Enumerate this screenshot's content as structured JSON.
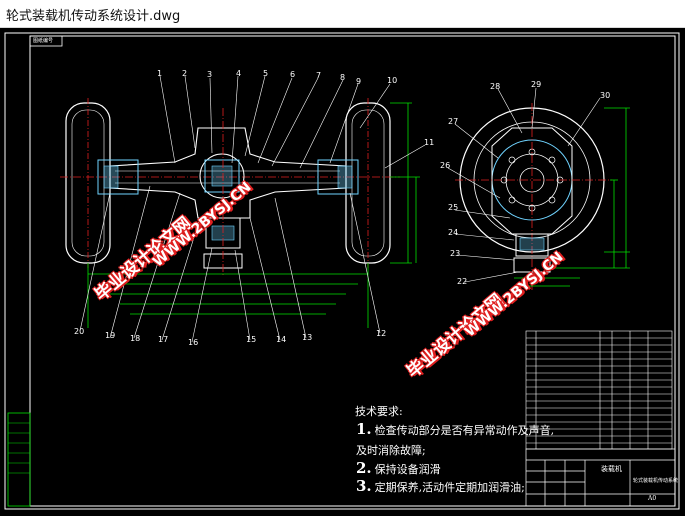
{
  "window": {
    "title": "轮式装载机传动系统设计.dwg"
  },
  "drawing": {
    "sheet_tag": "图纸编号",
    "callouts_top": [
      "1",
      "2",
      "3",
      "4",
      "5",
      "6",
      "7",
      "8",
      "9",
      "10",
      "11"
    ],
    "callouts_bottom": [
      "20",
      "19",
      "18",
      "17",
      "16",
      "15",
      "14",
      "13",
      "12"
    ],
    "callouts_side": [
      "28",
      "29",
      "30",
      "27",
      "26",
      "25",
      "24",
      "23",
      "22"
    ],
    "watermarks": [
      "毕业设计论文网",
      "WWW.2BYSJ.CN"
    ],
    "tech_notes": {
      "heading": "技术要求:",
      "items": [
        {
          "num": "1.",
          "text": "检查传动部分是否有异常动作及声音,"
        },
        {
          "num": "",
          "text": "及时消除故障;"
        },
        {
          "num": "2.",
          "text": "保持设备润滑"
        },
        {
          "num": "3.",
          "text": "定期保养,活动件定期加润滑油;"
        }
      ]
    },
    "title_block": {
      "name_label": "装载机",
      "drawing_title": "轮式装载机传动系统",
      "sheet": "A0"
    },
    "colors": {
      "background": "#000000",
      "outline": "#ffffff",
      "dimension": "#00e000",
      "centerline": "#e02020",
      "part": "#6fd3ff",
      "wheel": "#ffffff",
      "watermark": "#e02020"
    }
  }
}
